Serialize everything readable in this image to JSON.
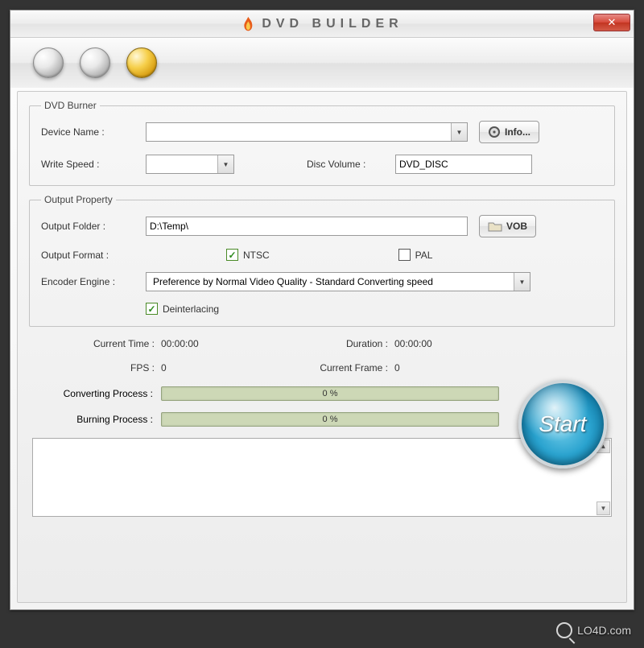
{
  "window": {
    "title": "DVD BUILDER",
    "close_symbol": "✕"
  },
  "toolbar": {
    "orbs": [
      "step-1",
      "step-2",
      "step-3"
    ],
    "active_index": 2
  },
  "dvd_burner": {
    "legend": "DVD Burner",
    "device_name_label": "Device Name :",
    "device_name_value": "",
    "info_button": "Info...",
    "write_speed_label": "Write Speed :",
    "write_speed_value": "",
    "disc_volume_label": "Disc Volume :",
    "disc_volume_value": "DVD_DISC"
  },
  "output": {
    "legend": "Output Property",
    "folder_label": "Output Folder :",
    "folder_value": "D:\\Temp\\",
    "vob_button": "VOB",
    "format_label": "Output Format :",
    "ntsc_label": "NTSC",
    "ntsc_checked": true,
    "pal_label": "PAL",
    "pal_checked": false,
    "encoder_label": "Encoder Engine :",
    "encoder_value": "Preference by Normal Video Quality - Standard Converting speed",
    "deinterlace_label": "Deinterlacing",
    "deinterlace_checked": true
  },
  "status": {
    "current_time_label": "Current Time :",
    "current_time_value": "00:00:00",
    "duration_label": "Duration :",
    "duration_value": "00:00:00",
    "fps_label": "FPS :",
    "fps_value": "0",
    "current_frame_label": "Current Frame :",
    "current_frame_value": "0",
    "converting_label": "Converting Process :",
    "converting_pct": "0 %",
    "burning_label": "Burning Process :",
    "burning_pct": "0 %"
  },
  "start_label": "Start",
  "log_text": "",
  "watermark": "LO4D.com"
}
